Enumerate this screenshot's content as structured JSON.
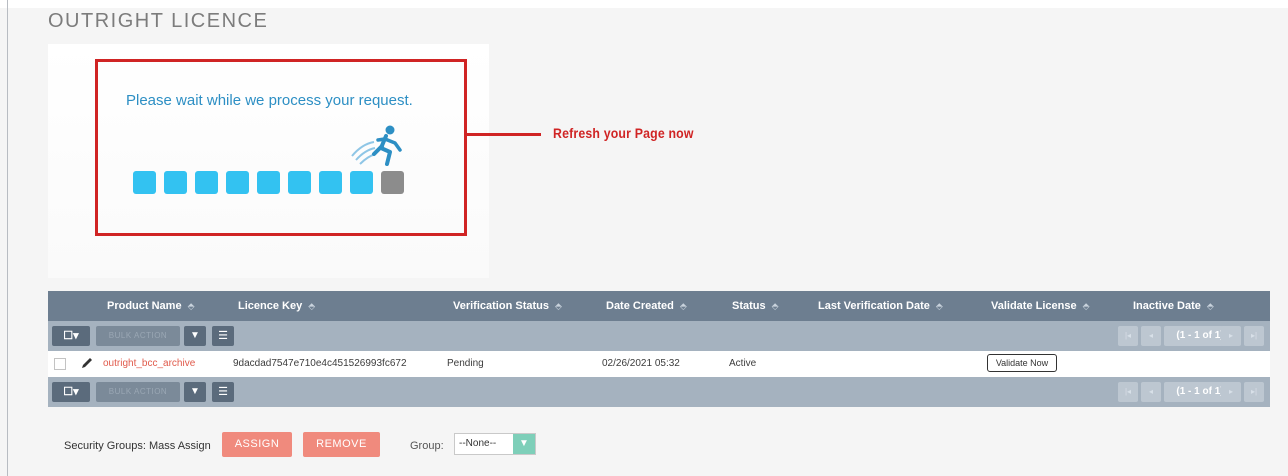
{
  "page": {
    "title": "OUTRIGHT LICENCE"
  },
  "processing": {
    "message": "Please wait while we process your request.",
    "total_blocks": 9,
    "completed_blocks": 8,
    "colors": {
      "active_block": "#33c2f1",
      "pending_block": "#8c8c8c",
      "highlight": "#d02424"
    }
  },
  "annotation": {
    "text": "Refresh your Page now"
  },
  "table": {
    "columns": [
      "Product Name",
      "Licence Key",
      "Verification Status",
      "Date Created",
      "Status",
      "Last Verification Date",
      "Validate License",
      "Inactive Date"
    ],
    "bulk_action_label": "BULK ACTION",
    "select_label": "▾",
    "pagination": "(1 - 1 of 1)",
    "rows": [
      {
        "product_name": "outright_bcc_archive",
        "licence_key": "9dacdad7547e710e4c451526993fc672",
        "verification_status": "Pending",
        "date_created": "02/26/2021 05:32",
        "status": "Active",
        "last_verification_date": "",
        "validate_button": "Validate Now",
        "inactive_date": ""
      }
    ]
  },
  "footer": {
    "security_groups_label": "Security Groups: Mass Assign",
    "assign_label": "ASSIGN",
    "remove_label": "REMOVE",
    "group_label": "Group:",
    "group_value": "--None--"
  }
}
